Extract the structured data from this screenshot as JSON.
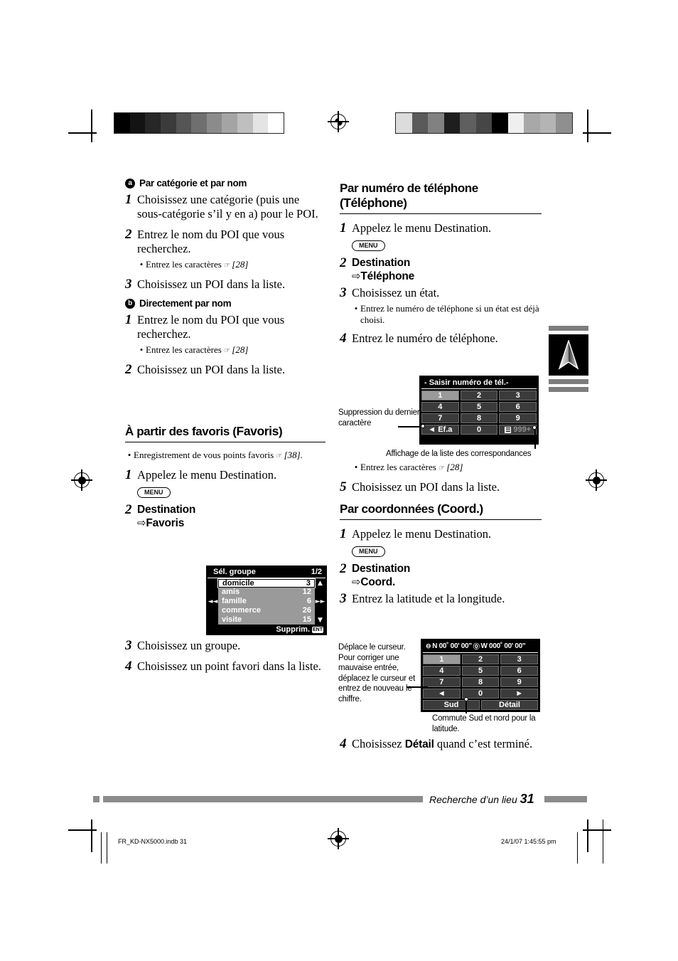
{
  "page": {
    "footer_title": "Recherche d’un lieu",
    "footer_number": "31",
    "print_file": "FR_KD-NX5000.indb   31",
    "print_timestamp": "24/1/07   1:45:55 pm"
  },
  "left_column": {
    "sub_a": {
      "marker": "a",
      "title": "Par catégorie et par nom",
      "steps": [
        {
          "num": "1",
          "text": "Choisissez une catégorie (puis une sous-catégorie s’il y en a) pour le POI."
        },
        {
          "num": "2",
          "text": "Entrez le nom du POI que vous recherchez."
        },
        {
          "num": "3",
          "text": "Choisissez un POI dans la liste."
        }
      ],
      "bullet": {
        "text": "Entrez les caractères",
        "ref": "[28]"
      }
    },
    "sub_b": {
      "marker": "b",
      "title": "Directement par nom",
      "steps": [
        {
          "num": "1",
          "text": "Entrez le nom du POI que vous recherchez."
        },
        {
          "num": "2",
          "text": "Choisissez un POI dans la liste."
        }
      ],
      "bullet": {
        "text": "Entrez les caractères",
        "ref": "[28]"
      }
    },
    "favoris": {
      "heading_prefix": "À partir des favoris (",
      "heading_ui": "Favoris",
      "heading_suffix": ")",
      "note": {
        "text": "Enregistrement de vous points favoris",
        "ref": "[38]."
      },
      "step1": {
        "num": "1",
        "text": "Appelez le menu Destination."
      },
      "menu_button": "MENU",
      "step2": {
        "num": "2",
        "line1": "Destination",
        "arrow": "⇨",
        "line2": "Favoris"
      },
      "step3": {
        "num": "3",
        "text": "Choisissez un groupe."
      },
      "step4": {
        "num": "4",
        "text": "Choisissez un point favori dans la liste."
      }
    }
  },
  "favoris_screen": {
    "title": "Sél. groupe",
    "page": "1/2",
    "nav_prev": "◄◄",
    "nav_next": "►►",
    "scroll_up": "▲",
    "scroll_down": "▼",
    "rows": [
      {
        "label": "domicile",
        "count": "3",
        "selected": true
      },
      {
        "label": "amis",
        "count": "12",
        "selected": false
      },
      {
        "label": "famille",
        "count": "6",
        "selected": false
      },
      {
        "label": "commerce",
        "count": "26",
        "selected": false
      },
      {
        "label": "visite",
        "count": "15",
        "selected": false
      }
    ],
    "footer_label": "Supprim.",
    "footer_key": "ENT"
  },
  "right_column": {
    "telephone": {
      "heading_line1": "Par numéro de téléphone",
      "heading_prefix": "(",
      "heading_ui": "Téléphone",
      "heading_suffix": ")",
      "step1": {
        "num": "1",
        "text": "Appelez le menu Destination."
      },
      "menu_button": "MENU",
      "step2": {
        "num": "2",
        "line1": "Destination",
        "arrow": "⇨",
        "line2": "Téléphone"
      },
      "step3": {
        "num": "3",
        "text": "Choisissez un état."
      },
      "step3_bullet": "Entrez le numéro de téléphone si un état est déjà choisi.",
      "step4": {
        "num": "4",
        "text": "Entrez le numéro de téléphone."
      },
      "bullet_chars": {
        "text": "Entrez les caractères",
        "ref": "[28]"
      },
      "step5": {
        "num": "5",
        "text": "Choisissez un POI dans la liste."
      },
      "callout_left": "Suppression du dernier caractère",
      "callout_bottom": "Affichage de la liste des correspondances"
    },
    "coordonnees": {
      "heading_prefix": "Par coordonnées (",
      "heading_ui": "Coord.",
      "heading_suffix": ")",
      "step1": {
        "num": "1",
        "text": "Appelez le menu Destination."
      },
      "menu_button": "MENU",
      "step2": {
        "num": "2",
        "line1": "Destination",
        "arrow": "⇨",
        "line2": "Coord."
      },
      "step3": {
        "num": "3",
        "text": "Entrez la latitude et la longitude."
      },
      "callout_left": "Déplace le curseur. Pour corriger une mauvaise entrée, déplacez le curseur et entrez de nouveau le chiffre.",
      "callout_bottom": "Commute Sud et nord pour la latitude.",
      "step4_num": "4",
      "step4_prefix": "Choisissez ",
      "step4_ui": "Détail",
      "step4_suffix": " quand c’est terminé."
    }
  },
  "phone_screen": {
    "title": "- Saisir numéro de tél.-",
    "keys_row1": [
      "1",
      "2",
      "3"
    ],
    "keys_row2": [
      "4",
      "5",
      "6"
    ],
    "keys_row3": [
      "7",
      "8",
      "9"
    ],
    "key_delete": "Ef.a",
    "key_delete_arrow": "◄",
    "key_zero": "0",
    "key_list_count": "999+",
    "lit_key": "1"
  },
  "coord_screen": {
    "header": "N 00˚ 00' 00\"   W 000˚ 00' 00\"",
    "header_lat": "N 00˚ 00' 00\"",
    "header_lon": "W 000˚ 00' 00\"",
    "keys_row1": [
      "1",
      "2",
      "3"
    ],
    "keys_row2": [
      "4",
      "5",
      "6"
    ],
    "keys_row3": [
      "7",
      "8",
      "9"
    ],
    "key_left_arrow": "◄",
    "key_zero": "0",
    "key_right_arrow": "►",
    "btn_sud": "Sud",
    "btn_detail": "Détail",
    "lit_key": "1"
  },
  "calibration": {
    "left_bar": [
      "#000000",
      "#131313",
      "#272727",
      "#3b3b3b",
      "#555555",
      "#6f6f6f",
      "#8b8b8b",
      "#a4a4a4",
      "#bfbfbf",
      "#e4e4e4",
      "#ffffff"
    ],
    "right_bar": [
      "#dcdcdc",
      "#5a5a5a",
      "#818181",
      "#1e1e1e",
      "#5f5f5f",
      "#464646",
      "#000000",
      "#efefef",
      "#a8a8a8",
      "#b4b4b4",
      "#8f8f8f"
    ]
  },
  "icons": {
    "nav_arrow": "navigation-arrow",
    "registration": "registration-mark"
  }
}
